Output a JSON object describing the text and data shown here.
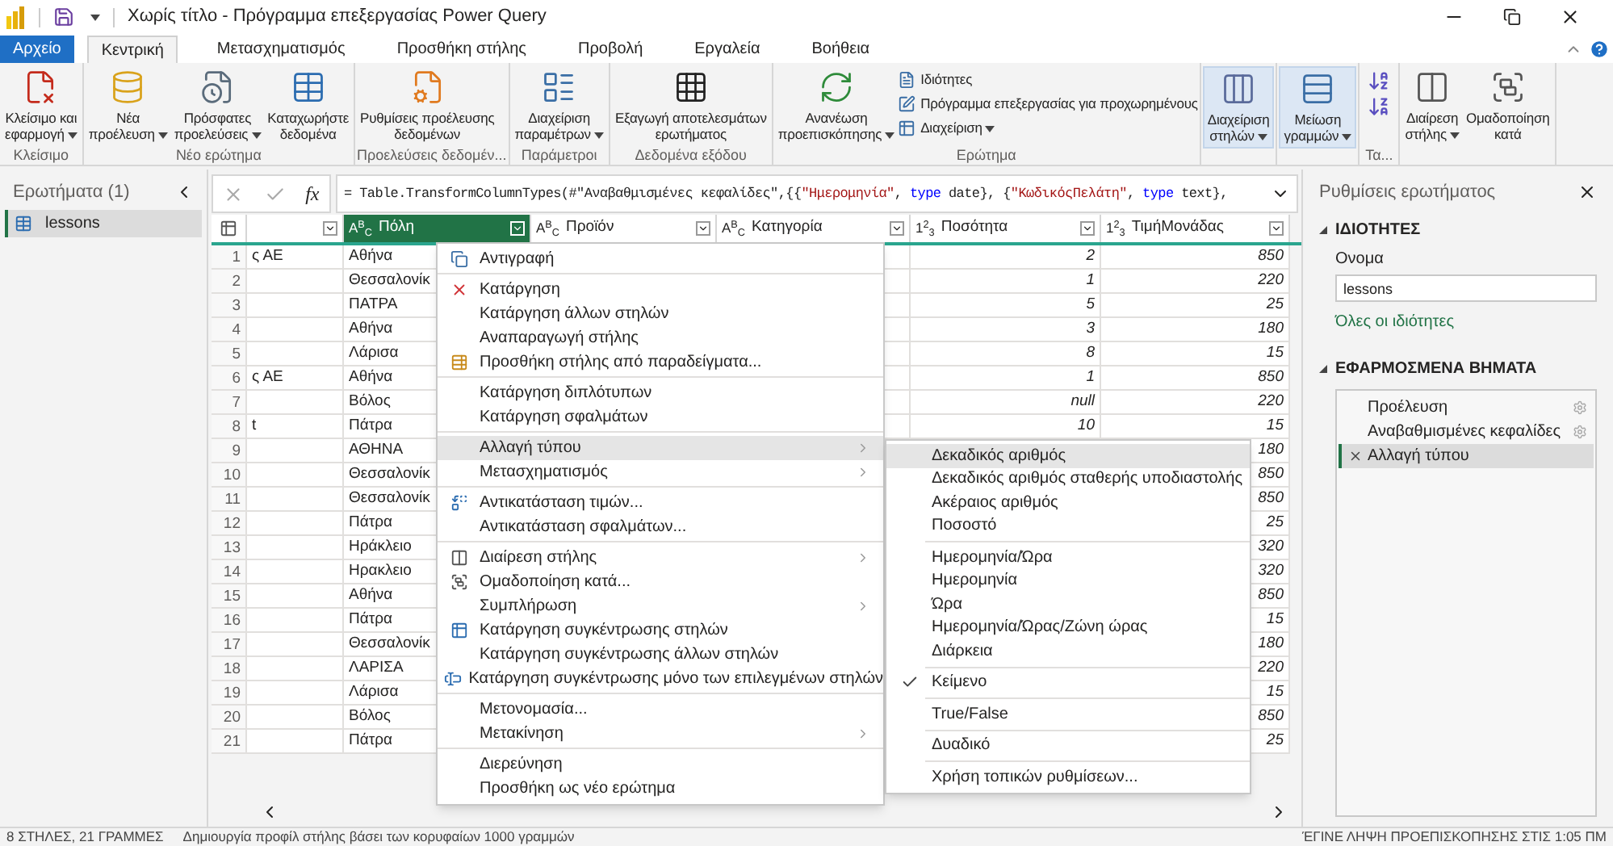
{
  "title_bar": {
    "title": "Χωρίς τίτλο - Πρόγραμμα επεξεργασίας Power Query"
  },
  "tabs": [
    {
      "label": "Αρχείο",
      "kind": "file",
      "selected": false
    },
    {
      "label": "Κεντρική",
      "kind": "tab",
      "selected": true
    },
    {
      "label": "Μετασχηματισμός",
      "kind": "tab",
      "selected": false
    },
    {
      "label": "Προσθήκη στήλης",
      "kind": "tab",
      "selected": false
    },
    {
      "label": "Προβολή",
      "kind": "tab",
      "selected": false
    },
    {
      "label": "Εργαλεία",
      "kind": "tab",
      "selected": false
    },
    {
      "label": "Βοήθεια",
      "kind": "tab",
      "selected": false
    }
  ],
  "ribbon": {
    "groups": [
      {
        "label": "Κλείσιμο",
        "kind": "normal",
        "buttons": [
          {
            "lines": [
              "Κλείσιμο και",
              "εφαρμογή"
            ],
            "dropdown": true
          }
        ]
      },
      {
        "label": "Νέο ερώτημα",
        "kind": "normal",
        "buttons": [
          {
            "lines": [
              "Νέα",
              "προέλευση"
            ],
            "dropdown": true
          },
          {
            "lines": [
              "Πρόσφατες",
              "προελεύσεις"
            ],
            "dropdown": true
          },
          {
            "lines": [
              "Καταχωρήστε",
              "δεδομένα"
            ],
            "dropdown": false
          }
        ]
      },
      {
        "label": "Προελεύσεις δεδομέν...",
        "kind": "normal",
        "buttons": [
          {
            "lines": [
              "Ρυθμίσεις προέλευσης",
              "δεδομένων"
            ],
            "dropdown": false
          }
        ]
      },
      {
        "label": "Παράμετροι",
        "kind": "normal",
        "buttons": [
          {
            "lines": [
              "Διαχείριση",
              "παραμέτρων"
            ],
            "dropdown": true
          }
        ]
      },
      {
        "label": "Δεδομένα εξόδου",
        "kind": "normal",
        "buttons": [
          {
            "lines": [
              "Εξαγωγή αποτελεσμάτων",
              "ερωτήματος"
            ],
            "dropdown": false
          }
        ]
      },
      {
        "label": "Ερώτημα",
        "kind": "normal",
        "buttons": [
          {
            "lines": [
              "Ανανέωση",
              "προεπισκόπησης"
            ],
            "dropdown": true
          }
        ],
        "small_buttons": [
          {
            "label": "Ιδιότητες",
            "dropdown": false
          },
          {
            "label": "Πρόγραμμα επεξεργασίας για προχωρημένους",
            "dropdown": false
          },
          {
            "label": "Διαχείριση",
            "dropdown": true
          }
        ]
      },
      {
        "kind": "collapsed",
        "buttons": [
          {
            "lines": [
              "Διαχείριση",
              "στηλών"
            ],
            "dropdown": true
          }
        ]
      },
      {
        "kind": "collapsed",
        "buttons": [
          {
            "lines": [
              "Μείωση",
              "γραμμών"
            ],
            "dropdown": true
          }
        ]
      },
      {
        "label": "Τα...",
        "kind": "sort"
      },
      {
        "kind": "normal",
        "buttons": [
          {
            "lines": [
              "Διαίρεση",
              "στήλης"
            ],
            "dropdown": true
          },
          {
            "lines": [
              "Ομαδοποίηση",
              "κατά"
            ],
            "dropdown": false
          }
        ]
      }
    ]
  },
  "queries_pane": {
    "title": "Ερωτήματα (1)",
    "items": [
      {
        "label": "lessons",
        "selected": true
      }
    ]
  },
  "formula_bar": {
    "fx_label": "fx",
    "segments": [
      {
        "kind": "plain",
        "text": "= Table.TransformColumnTypes(#\"Αναβαθμισμένες κεφαλίδες\",{{"
      },
      {
        "kind": "string",
        "text": "\"Ημερομηνία\""
      },
      {
        "kind": "plain",
        "text": ", "
      },
      {
        "kind": "keyword",
        "text": "type"
      },
      {
        "kind": "plain",
        "text": " date}, {"
      },
      {
        "kind": "string",
        "text": "\"ΚωδικόςΠελάτη\""
      },
      {
        "kind": "plain",
        "text": ", "
      },
      {
        "kind": "keyword",
        "text": "type"
      },
      {
        "kind": "plain",
        "text": " text},"
      }
    ]
  },
  "table": {
    "columns": [
      {
        "kind": "blank",
        "selected": false
      },
      {
        "kind": "text",
        "type_icon": "A$^{B}$$_{C}$",
        "label": "Πόλη",
        "selected": true
      },
      {
        "kind": "text",
        "type_icon": "A$^{B}$$_{C}$",
        "label": "Προϊόν",
        "selected": false
      },
      {
        "kind": "text",
        "type_icon": "A$^{B}$$_{C}$",
        "label": "Κατηγορία",
        "selected": false
      },
      {
        "kind": "number",
        "type_icon": "1$^{2}$$_{3}$",
        "label": "Ποσότητα",
        "selected": false
      },
      {
        "kind": "number",
        "type_icon": "1$^{2}$$_{3}$",
        "label": "ΤιμήΜονάδας",
        "selected": false
      }
    ],
    "rows": [
      {
        "index": "1",
        "column_1": "ς ΑΕ",
        "city": "Αθήνα",
        "quantity": "2",
        "unit_price": "850"
      },
      {
        "index": "2",
        "city": "Θεσσαλονίκ",
        "quantity": "1",
        "unit_price": "220"
      },
      {
        "index": "3",
        "city": "ΠΑΤΡΑ",
        "quantity": "5",
        "unit_price": "25"
      },
      {
        "index": "4",
        "city": "Αθήνα",
        "quantity": "3",
        "unit_price": "180"
      },
      {
        "index": "5",
        "city": "Λάρισα",
        "quantity": "8",
        "unit_price": "15"
      },
      {
        "index": "6",
        "column_1": "ς ΑΕ",
        "city": "Αθήνα",
        "quantity": "1",
        "unit_price": "850"
      },
      {
        "index": "7",
        "city": "Βόλος",
        "quantity": "null",
        "unit_price": "220"
      },
      {
        "index": "8",
        "column_1": "t",
        "city": "Πάτρα",
        "quantity": "10",
        "unit_price": "15"
      },
      {
        "index": "9",
        "city": "ΑΘΗΝΑ",
        "unit_price": "180"
      },
      {
        "index": "10",
        "city": "Θεσσαλονίκ",
        "unit_price": "850"
      },
      {
        "index": "11",
        "city": "Θεσσαλονίκ",
        "unit_price": "850"
      },
      {
        "index": "12",
        "city": "Πάτρα",
        "unit_price": "25"
      },
      {
        "index": "13",
        "city": "Ηράκλειο",
        "unit_price": "320"
      },
      {
        "index": "14",
        "city": "Ηρακλειο",
        "unit_price": "320"
      },
      {
        "index": "15",
        "city": "Αθήνα",
        "unit_price": "850"
      },
      {
        "index": "16",
        "city": "Πάτρα",
        "unit_price": "15"
      },
      {
        "index": "17",
        "city": "Θεσσαλονίκ",
        "unit_price": "180"
      },
      {
        "index": "18",
        "city": "ΛΑΡΙΣΑ",
        "unit_price": "220"
      },
      {
        "index": "19",
        "city": "Λάρισα",
        "unit_price": "15"
      },
      {
        "index": "20",
        "city": "Βόλος",
        "unit_price": "850"
      },
      {
        "index": "21",
        "city": "Πάτρα",
        "unit_price": "25"
      }
    ]
  },
  "context_menu": {
    "groups": [
      [
        {
          "label": "Αντιγραφή",
          "submenu": false,
          "selected": false
        }
      ],
      [
        {
          "label": "Κατάργηση",
          "submenu": false,
          "selected": false
        },
        {
          "label": "Κατάργηση άλλων στηλών",
          "submenu": false,
          "selected": false
        },
        {
          "label": "Αναπαραγωγή στήλης",
          "submenu": false,
          "selected": false
        },
        {
          "label": "Προσθήκη στήλης από παραδείγματα...",
          "submenu": false,
          "selected": false
        }
      ],
      [
        {
          "label": "Κατάργηση διπλότυπων",
          "submenu": false,
          "selected": false
        },
        {
          "label": "Κατάργηση σφαλμάτων",
          "submenu": false,
          "selected": false
        }
      ],
      [
        {
          "label": "Αλλαγή τύπου",
          "submenu": true,
          "selected": true
        },
        {
          "label": "Μετασχηματισμός",
          "submenu": true,
          "selected": false
        }
      ],
      [
        {
          "label": "Αντικατάσταση τιμών...",
          "submenu": false,
          "selected": false
        },
        {
          "label": "Αντικατάσταση σφαλμάτων...",
          "submenu": false,
          "selected": false
        }
      ],
      [
        {
          "label": "Διαίρεση στήλης",
          "submenu": true,
          "selected": false
        },
        {
          "label": "Ομαδοποίηση κατά...",
          "submenu": false,
          "selected": false
        },
        {
          "label": "Συμπλήρωση",
          "submenu": true,
          "selected": false
        },
        {
          "label": "Κατάργηση συγκέντρωσης στηλών",
          "submenu": false,
          "selected": false
        },
        {
          "label": "Κατάργηση συγκέντρωσης άλλων στηλών",
          "submenu": false,
          "selected": false
        },
        {
          "label": "Κατάργηση συγκέντρωσης μόνο των επιλεγμένων στηλών",
          "submenu": false,
          "selected": false
        }
      ],
      [
        {
          "label": "Μετονομασία...",
          "submenu": false,
          "selected": false
        },
        {
          "label": "Μετακίνηση",
          "submenu": true,
          "selected": false
        }
      ],
      [
        {
          "label": "Διερεύνηση",
          "submenu": false,
          "selected": false
        },
        {
          "label": "Προσθήκη ως νέο ερώτημα",
          "submenu": false,
          "selected": false
        }
      ]
    ]
  },
  "type_menu": {
    "groups": [
      [
        {
          "label": "Δεκαδικός αριθμός",
          "selected": true,
          "checked": false
        },
        {
          "label": "Δεκαδικός αριθμός σταθερής υποδιαστολής",
          "selected": false,
          "checked": false
        },
        {
          "label": "Ακέραιος αριθμός",
          "selected": false,
          "checked": false
        },
        {
          "label": "Ποσοστό",
          "selected": false,
          "checked": false
        }
      ],
      [
        {
          "label": "Ημερομηνία/Ώρα",
          "selected": false,
          "checked": false
        },
        {
          "label": "Ημερομηνία",
          "selected": false,
          "checked": false
        },
        {
          "label": "Ώρα",
          "selected": false,
          "checked": false
        },
        {
          "label": "Ημερομηνία/Ώρας/Ζώνη ώρας",
          "selected": false,
          "checked": false
        },
        {
          "label": "Διάρκεια",
          "selected": false,
          "checked": false
        }
      ],
      [
        {
          "label": "Κείμενο",
          "selected": false,
          "checked": true
        }
      ],
      [
        {
          "label": "True/False",
          "selected": false,
          "checked": false
        }
      ],
      [
        {
          "label": "Δυαδικό",
          "selected": false,
          "checked": false
        }
      ],
      [
        {
          "label": "Χρήση τοπικών ρυθμίσεων...",
          "selected": false,
          "checked": false
        }
      ]
    ]
  },
  "settings_pane": {
    "title": "Ρυθμίσεις ερωτήματος",
    "properties": {
      "heading": "ΙΔΙΟΤΗΤΕΣ",
      "name_label": "Ονομα",
      "name_value": "lessons",
      "all_properties_link": "Όλες οι ιδιότητες"
    },
    "steps": {
      "heading": "ΕΦΑΡΜΟΣΜΕΝΑ ΒΗΜΑΤΑ",
      "items": [
        {
          "label": "Προέλευση",
          "selected": false,
          "has_settings": true
        },
        {
          "label": "Αναβαθμισμένες κεφαλίδες",
          "selected": false,
          "has_settings": true
        },
        {
          "label": "Αλλαγή τύπου",
          "selected": true,
          "has_settings": false
        }
      ]
    }
  },
  "status_bar": {
    "summary": "8 ΣΤΗΛΕΣ, 21 ΓΡΑΜΜΕΣ",
    "profiling": "Δημιουργία προφίλ στήλης βάσει των κορυφαίων 1000 γραμμών",
    "preview": "ΈΓΙΝΕ ΛΗΨΗ ΠΡΟΕΠΙΣΚΟΠΗΣΗΣ ΣΤΙΣ 1:05 ΠΜ"
  }
}
